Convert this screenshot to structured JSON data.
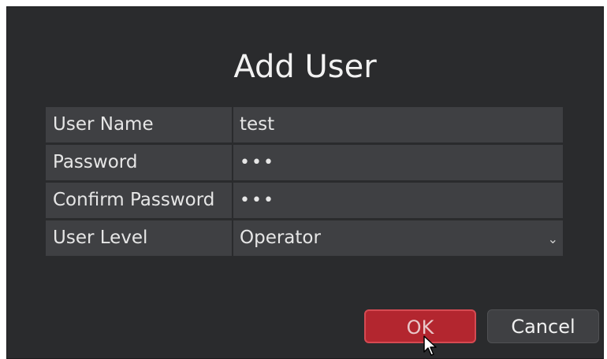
{
  "dialog": {
    "title": "Add User",
    "fields": [
      {
        "label": "User Name",
        "value": "test"
      },
      {
        "label": "Password",
        "value": "•••"
      },
      {
        "label": "Confirm Password",
        "value": "•••"
      },
      {
        "label": "User Level",
        "value": "Operator"
      }
    ],
    "ok_label": "OK",
    "cancel_label": "Cancel"
  },
  "icons": {
    "dropdown": "chevron-down-icon",
    "cursor": "mouse-pointer-icon"
  },
  "colors": {
    "dialog_bg": "#2a2b2d",
    "field_bg": "#3f4043",
    "ok_bg": "#b3262f",
    "text": "#e6e6e6"
  }
}
